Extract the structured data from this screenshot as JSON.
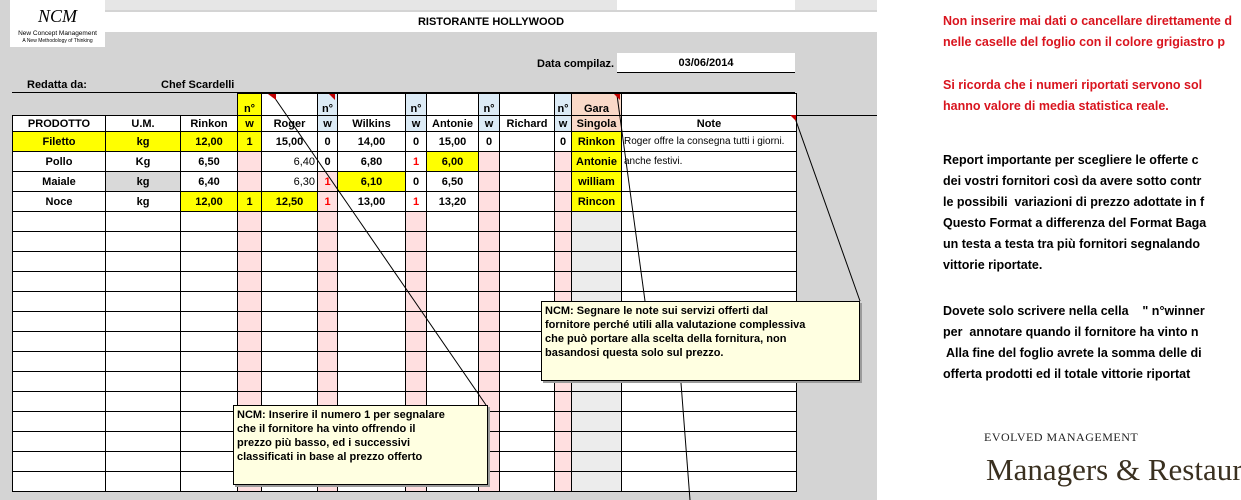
{
  "logo": {
    "mark": "NCM",
    "line1": "New Concept Management",
    "line2": "A New Methodology of Thinking"
  },
  "sheet": {
    "title": "RISTORANTE HOLLYWOOD",
    "date_label": "Data compilaz.",
    "date_value": "03/06/2014",
    "author_label": "Redatta da:",
    "author_value": "Chef Scardelli"
  },
  "table": {
    "win_marker": "n°",
    "win_letter": "w",
    "headers": [
      "PRODOTTO",
      "U.M.",
      "Rinkon",
      "Roger",
      "Wilkins",
      "Antonie",
      "Richard"
    ],
    "gara_top": "Gara",
    "gara_bottom": "Singola",
    "note_header": "Note",
    "rows": [
      {
        "product": "Filetto",
        "um": "kg",
        "rinkon": "12,00",
        "w1": "1",
        "roger": "15,00",
        "w2": "0",
        "wilkins": "14,00",
        "w3": "0",
        "antonie": "15,00",
        "w4": "0",
        "richard": "",
        "w5": "0",
        "gara": "Rinkon",
        "note": "Roger offre la consegna  tutti i giorni."
      },
      {
        "product": "Pollo",
        "um": "Kg",
        "rinkon": "6,50",
        "w1": "",
        "roger": "6,40",
        "w2": "0",
        "wilkins": "6,80",
        "w3": "1",
        "antonie": "6,00",
        "w4": "",
        "richard": "",
        "w5": "",
        "gara": "Antonie",
        "note": "anche festivi."
      },
      {
        "product": "Maiale",
        "um": "kg",
        "rinkon": "6,40",
        "w1": "",
        "roger": "6,30",
        "w2": "1",
        "wilkins": "6,10",
        "w3": "0",
        "antonie": "6,50",
        "w4": "",
        "richard": "",
        "w5": "",
        "gara": "william",
        "note": ""
      },
      {
        "product": "Noce",
        "um": "kg",
        "rinkon": "12,00",
        "w1": "1",
        "roger": "12,50",
        "w2": "1",
        "wilkins": "13,00",
        "w3": "1",
        "antonie": "13,20",
        "w4": "",
        "richard": "",
        "w5": "",
        "gara": "Rincon",
        "note": ""
      }
    ],
    "empty_rows": 14
  },
  "callouts": {
    "notes_tip": "NCM: Segnare le note sui servizi offerti dal\nfornitore perché utili alla valutazione complessiva\nche può portare alla scelta della fornitura, non\nbasandosi questa solo sul prezzo.",
    "winner_tip": "NCM: Inserire il numero 1 per segnalare\nche il fornitore ha vinto offrendo il\nprezzo più  basso, ed i successivi\nclassificati in base al prezzo offerto"
  },
  "instructions": {
    "warning1": "Non inserire mai dati o cancellare direttamente d\nnelle caselle del foglio con il colore grigiastro p",
    "warning2": "Si ricorda che i numeri riportati servono sol\nhanno valore di media statistica reale.",
    "body1": "Report importante per scegliere le offerte c\ndei vostri fornitori così da avere sotto contr\nle possibili  variazioni di prezzo adottate in f\nQuesto Format a differenza del Format Baga\nun testa a testa tra più fornitori segnalando\nvittorie riportate.",
    "body2": "Dovete solo scrivere nella cella    \" n°winner\nper  annotare quando il fornitore ha vinto n\n Alla fine del foglio avrete la somma delle di\nofferta prodotti ed il totale vittorie riportat"
  },
  "brand": {
    "tagline": "EVOLVED MANAGEMENT",
    "name": "Managers & Restaurat"
  },
  "colors": {
    "warning_red": "#d9141e",
    "highlight_yellow": "#ffff00",
    "win_column_pink": "#ffdfe0",
    "win_column_blue": "#dcebf6",
    "callout_bg": "#ffffe1"
  }
}
